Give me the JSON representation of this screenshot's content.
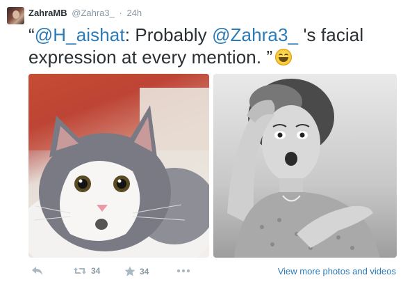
{
  "tweet": {
    "fullname": "ZahraMB",
    "username": "@Zahra3_",
    "separator": "·",
    "time": "24h",
    "text_open_quote": "“",
    "mention_1": "@H_aishat",
    "text_part_1": ": Probably ",
    "mention_2": "@Zahra3_",
    "text_part_2": " 's facial expression at every mention. ”",
    "emoji": "grinning-face-with-smiling-eyes"
  },
  "media": {
    "photos": [
      {
        "subject": "grey-and-white-cat"
      },
      {
        "subject": "surprised-woman-vintage-photo"
      }
    ],
    "view_more_label": "View more photos and videos"
  },
  "actions": {
    "retweet_count": "34",
    "favorite_count": "34"
  },
  "colors": {
    "link": "#2b7bb9",
    "text": "#292f33",
    "muted": "#8899a6"
  }
}
